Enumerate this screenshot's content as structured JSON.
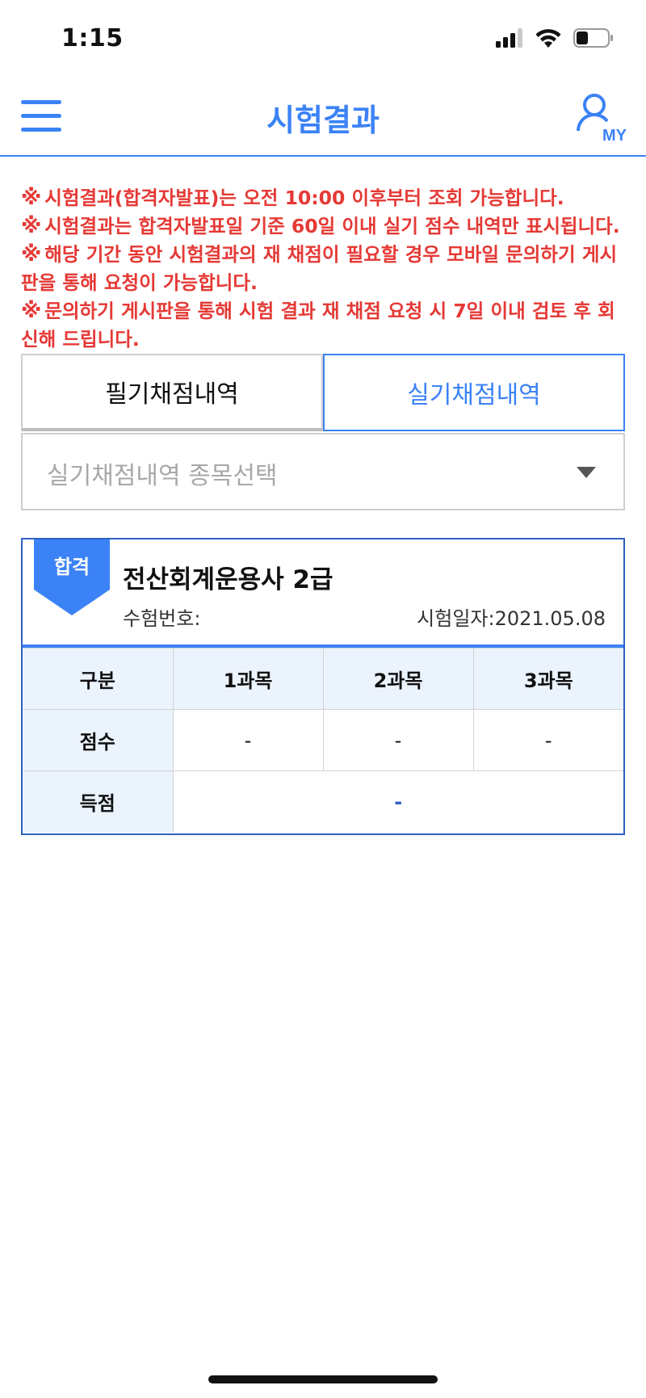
{
  "status_bar": {
    "time": "1:15"
  },
  "header": {
    "title": "시험결과",
    "my_label": "MY"
  },
  "notices": [
    {
      "mark": "※",
      "text": "시험결과(합격자발표)는 오전 10:00 이후부터 조회 가능합니다."
    },
    {
      "mark": "※",
      "text": "시험결과는 합격자발표일 기준 60일 이내 실기 점수 내역만 표시됩니다."
    },
    {
      "mark": "※",
      "text": "해당 기간 동안 시험결과의 재 채점이 필요할 경우 모바일 문의하기 게시판을 통해 요청이 가능합니다."
    },
    {
      "mark": "※",
      "text": "문의하기 게시판을 통해 시험 결과 재 채점 요청 시 7일 이내 검토 후 회신해 드립니다."
    }
  ],
  "tabs": {
    "written": "필기채점내역",
    "practical": "실기채점내역"
  },
  "select": {
    "placeholder": "실기채점내역 종목선택"
  },
  "result": {
    "badge": "합격",
    "exam_name": "전산회계운용사 2급",
    "exam_number_label": "수험번호:",
    "exam_date": "시험일자:2021.05.08",
    "table": {
      "headers": [
        "구분",
        "1과목",
        "2과목",
        "3과목"
      ],
      "score_label": "점수",
      "scores": [
        "-",
        "-",
        "-"
      ],
      "total_label": "득점",
      "total": "-"
    }
  },
  "colors": {
    "accent": "#3b82f6",
    "notice": "#e53935",
    "card_border": "#2f5fc4",
    "table_header_bg": "#ebf3fd"
  }
}
